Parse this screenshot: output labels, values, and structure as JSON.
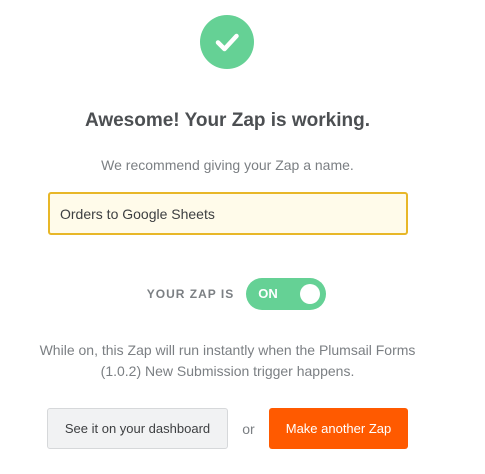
{
  "status_icon": {
    "name": "checkmark-icon",
    "color": "#65d195"
  },
  "heading": "Awesome! Your Zap is working.",
  "subheading": "We recommend giving your Zap a name.",
  "zap_name": {
    "value": "Orders to Google Sheets",
    "highlight_color": "#e8b728"
  },
  "zap_status": {
    "label": "YOUR ZAP IS",
    "toggle_text": "ON",
    "is_on": true,
    "color": "#65d195"
  },
  "description": "While on, this Zap will run instantly when the Plumsail Forms (1.0.2) New Submission trigger happens.",
  "actions": {
    "dashboard_label": "See it on your dashboard",
    "or_text": "or",
    "make_another_label": "Make another Zap",
    "primary_color": "#ff5a00"
  }
}
